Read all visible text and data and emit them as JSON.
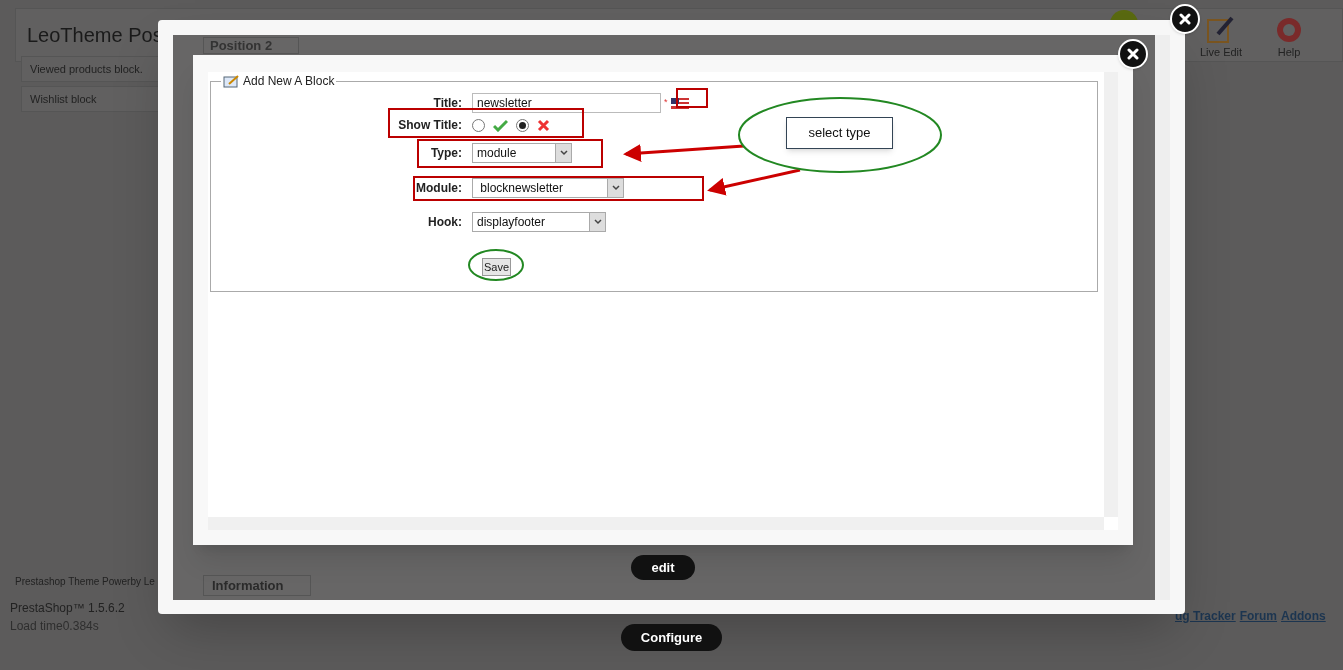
{
  "page": {
    "title": "LeoTheme Pos",
    "sidebar_items": [
      {
        "label": "Viewed products block."
      },
      {
        "label": "Wishlist block"
      }
    ],
    "toolbar": [
      {
        "kind": "edit",
        "label": "Live Edit"
      },
      {
        "kind": "help",
        "label": "Help"
      }
    ],
    "footer": {
      "credit": "Prestashop Theme Powerby Le",
      "version": "PrestaShop™ 1.5.6.2",
      "load_time": "Load time0.384s",
      "links": [
        "ug Tracker",
        "Forum",
        "Addons"
      ]
    }
  },
  "outer_dialog": {
    "sections": [
      "Position 2",
      "Information"
    ],
    "edit_button": "edit"
  },
  "configure_button": "Configure",
  "form": {
    "legend": "Add New A Block",
    "fields": [
      {
        "kind": "text",
        "label": "Title:",
        "value": "newsletter",
        "required_mark": "*"
      },
      {
        "kind": "radio",
        "label": "Show Title:",
        "options": [
          {
            "selected": false
          },
          {
            "selected": true
          }
        ]
      },
      {
        "kind": "select",
        "label": "Type:",
        "value": "module"
      },
      {
        "kind": "select",
        "label": "Module:",
        "value": " blocknewsletter"
      },
      {
        "kind": "select",
        "label": "Hook:",
        "value": "displayfooter"
      }
    ],
    "save_button": "Save"
  },
  "annotations": {
    "callout": "select type"
  }
}
